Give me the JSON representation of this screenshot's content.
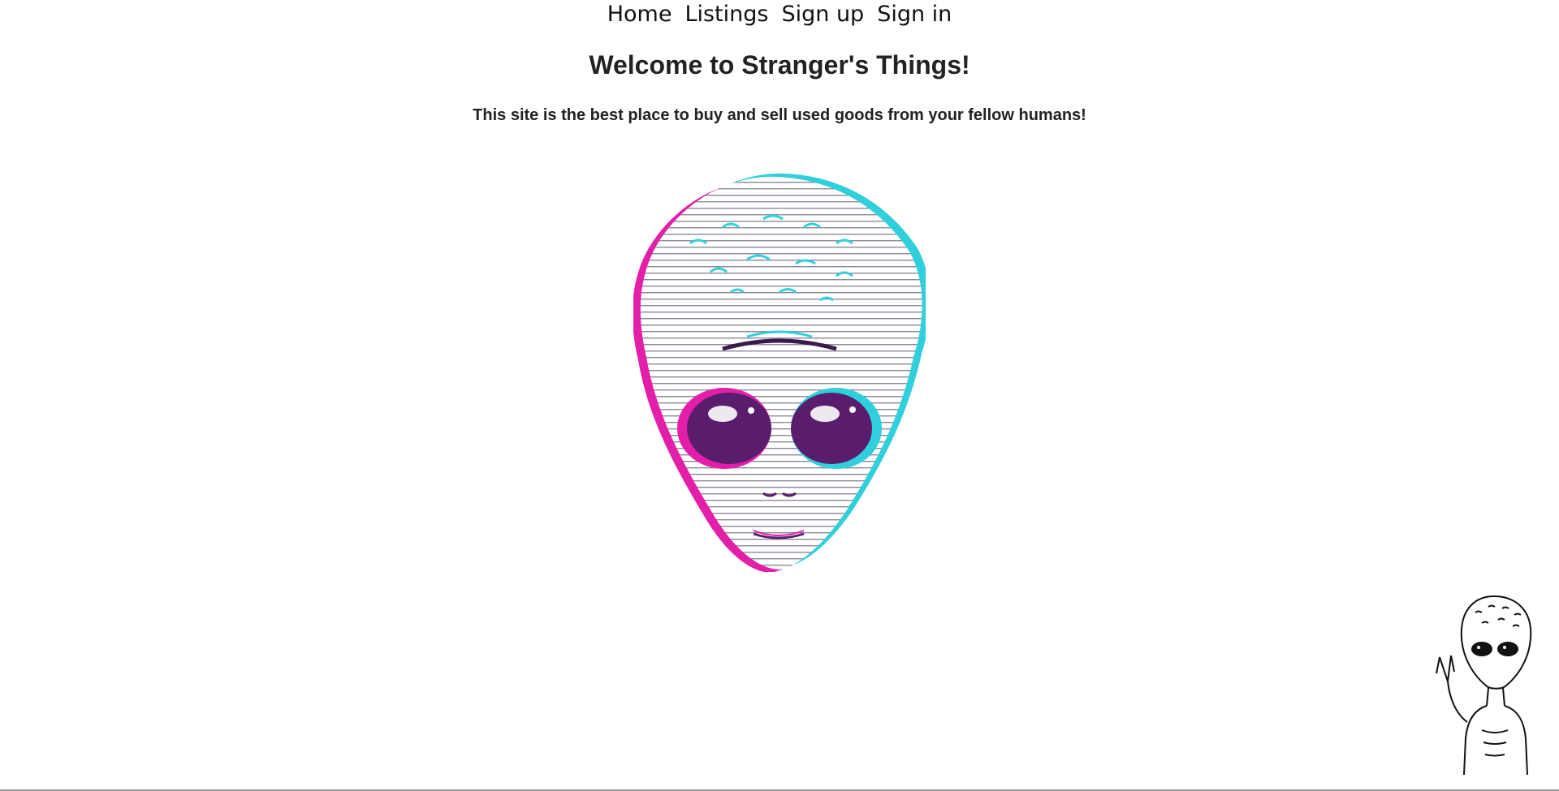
{
  "nav": {
    "items": [
      {
        "label": "Home"
      },
      {
        "label": "Listings"
      },
      {
        "label": "Sign up"
      },
      {
        "label": "Sign in"
      }
    ]
  },
  "main": {
    "heading": "Welcome to Stranger's Things!",
    "tagline": "This site is the best place to buy and sell used goods from your fellow humans!"
  },
  "images": {
    "hero": {
      "icon": "alien-head-glitch-illustration",
      "colors": [
        "#e31ea8",
        "#2fd0dc",
        "#5a1d6e",
        "#ffffff"
      ]
    },
    "corner": {
      "icon": "alien-peace-sign-sketch"
    }
  }
}
